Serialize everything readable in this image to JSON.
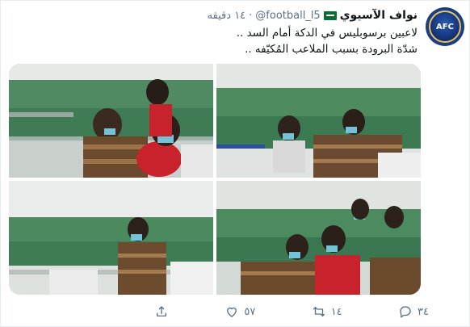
{
  "tweet": {
    "display_name": "نواف الآسيوي",
    "handle": "@football_l5",
    "separator": "·",
    "time": "١٤ دقيقه",
    "text_lines": [
      "لاعبين برسوبليس في الدكة أمام السد ..",
      "شدّة البرودة بسبب الملاعب المُكيّفه .."
    ],
    "avatar_text": "AFC"
  },
  "actions": {
    "replies": "٣٤",
    "retweets": "١٤",
    "likes": "٥٧"
  },
  "colors": {
    "secondary_text": "#5b7083",
    "border": "#e6ecf0",
    "stadium_green": "#2f7d4a",
    "jersey_red": "#c8232c"
  },
  "icons": [
    "verified-flag-icon",
    "reply-icon",
    "retweet-icon",
    "like-icon",
    "share-icon"
  ]
}
